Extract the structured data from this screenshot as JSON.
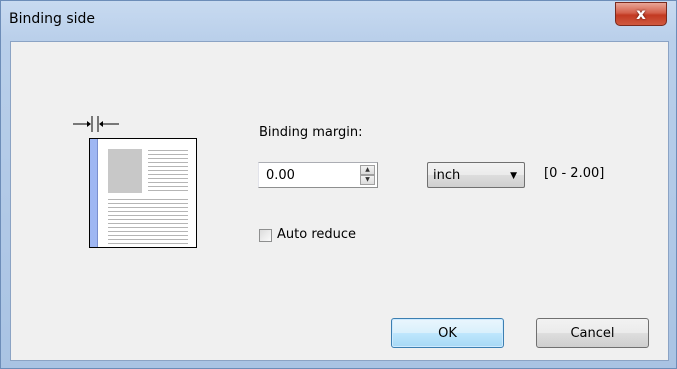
{
  "window": {
    "title": "Binding side",
    "close_label": "x"
  },
  "form": {
    "binding_margin_label": "Binding margin:",
    "binding_margin_value": "0.00",
    "unit": "inch",
    "range": "[0 - 2.00]",
    "auto_reduce_label": "Auto reduce",
    "auto_reduce_checked": false
  },
  "buttons": {
    "ok": "OK",
    "cancel": "Cancel"
  },
  "icons": {
    "close": "close-icon",
    "spin_up": "spin-up-icon",
    "spin_down": "spin-down-icon",
    "dropdown": "chevron-down-icon",
    "margin": "binding-margin-icon"
  }
}
